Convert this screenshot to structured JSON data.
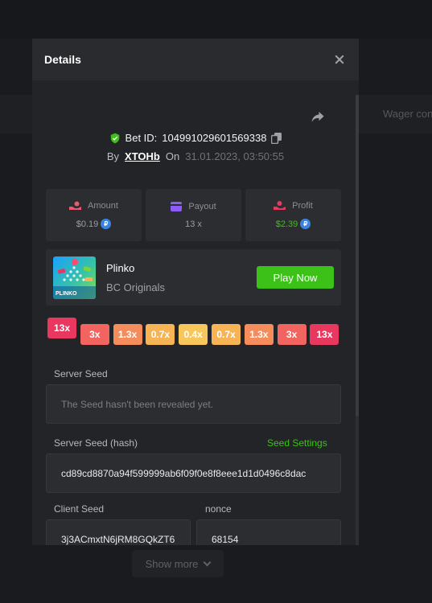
{
  "background": {
    "wager_text": "Wager con",
    "show_more_label": "Show more"
  },
  "modal": {
    "title": "Details",
    "bet": {
      "label": "Bet ID:",
      "id": "104991029601569338",
      "by_label": "By",
      "user": "XTOHb",
      "on_label": "On",
      "date": "31.01.2023, 03:50:55"
    },
    "stats": [
      {
        "label": "Amount",
        "value": "$0.19",
        "icon": "money-hand-icon"
      },
      {
        "label": "Payout",
        "value": "13 x",
        "icon": "card-icon"
      },
      {
        "label": "Profit",
        "value": "$2.39",
        "icon": "profit-hand-icon"
      }
    ],
    "coin_symbol": "₽",
    "game": {
      "name": "Plinko",
      "provider": "BC Originals",
      "thumb_text": "PLINKO",
      "play_label": "Play Now"
    },
    "multipliers": [
      "13x",
      "3x",
      "1.3x",
      "0.7x",
      "0.4x",
      "0.7x",
      "1.3x",
      "3x",
      "13x"
    ],
    "multiplier_colors": [
      "#e8385f",
      "#f26460",
      "#f58c5c",
      "#f7b455",
      "#f8c75c",
      "#f7b455",
      "#f58c5c",
      "#f26460",
      "#e8385f"
    ],
    "fields": {
      "server_seed_label": "Server Seed",
      "server_seed_value": "The Seed hasn't been revealed yet.",
      "server_hash_label": "Server Seed (hash)",
      "seed_settings_label": "Seed Settings",
      "server_hash_value": "cd89cd8870a94f599999ab6f09f0e8f8eee1d1d0496c8dac",
      "client_seed_label": "Client Seed",
      "client_seed_value": "3j3ACmxtN6jRM8GQkZT6",
      "nonce_label": "nonce",
      "nonce_value": "68154"
    },
    "colors": {
      "accent_green": "#3bc117",
      "panel": "#2c2d31",
      "modal_bg": "#232427"
    }
  }
}
